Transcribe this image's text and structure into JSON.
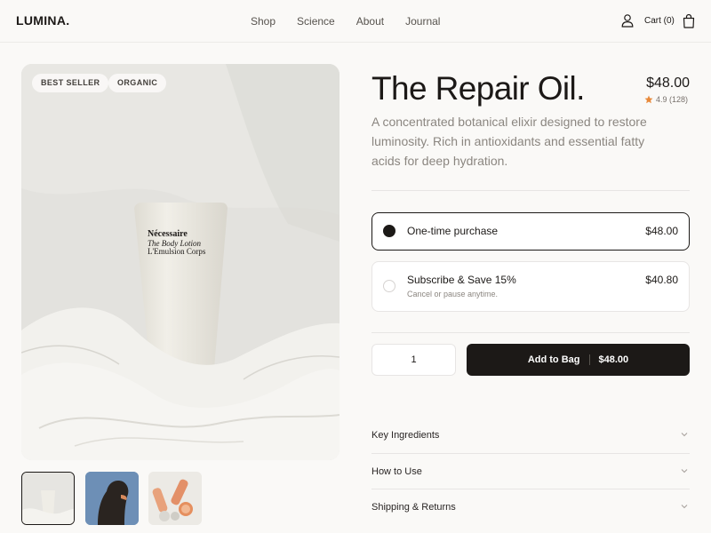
{
  "header": {
    "logo": "LUMINA.",
    "nav": [
      "Shop",
      "Science",
      "About",
      "Journal"
    ],
    "cart_label": "Cart (0)",
    "icons": [
      "user-icon",
      "shopping-bag-icon"
    ]
  },
  "gallery": {
    "badges": [
      "BEST SELLER",
      "ORGANIC"
    ],
    "product_label": {
      "brand": "Nécessaire",
      "line1": "The Body Lotion",
      "line2": "L'Emulsion Corps"
    },
    "selected_thumbnail": 1,
    "thumbnail_count": 3
  },
  "product": {
    "title": "The Repair Oil.",
    "price": "$48.00",
    "rating": "4.9 (128)",
    "description": "A concentrated botanical elixir designed to restore luminosity. Rich in antioxidants and essential fatty acids for deep hydration."
  },
  "purchase_options": {
    "selected": "one_time",
    "one_time": {
      "label": "One-time purchase",
      "price": "$48.00"
    },
    "subscribe": {
      "label": "Subscribe & Save 15%",
      "note": "Cancel or pause anytime.",
      "price": "$40.80"
    }
  },
  "cart": {
    "quantity": "1",
    "add_label": "Add to Bag",
    "add_price": "$48.00"
  },
  "accordion": [
    "Key Ingredients",
    "How to Use",
    "Shipping & Returns"
  ],
  "colors": {
    "background": "#faf9f7",
    "primary": "#1c1917",
    "star": "#e8893a",
    "muted_text": "#8b8680"
  }
}
